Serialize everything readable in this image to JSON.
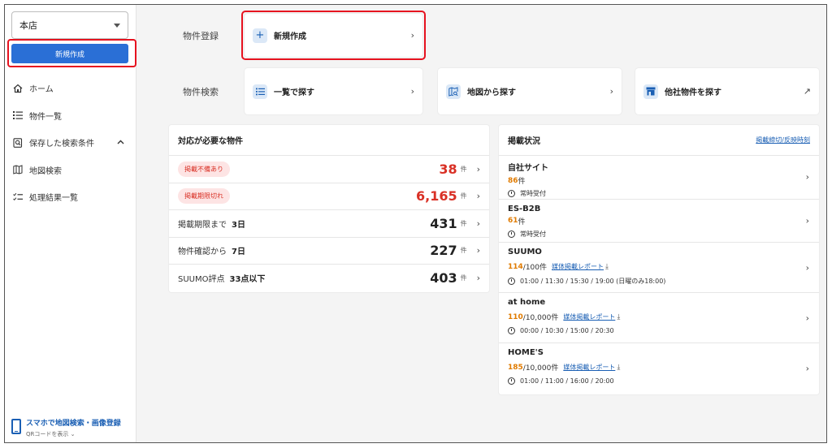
{
  "sidebar": {
    "store": "本店",
    "create_label": "新規作成",
    "nav": [
      {
        "label": "ホーム",
        "icon": "home-icon"
      },
      {
        "label": "物件一覧",
        "icon": "list-icon"
      },
      {
        "label": "保存した検索条件",
        "icon": "saved-search-icon",
        "expanded": true
      },
      {
        "label": "地図検索",
        "icon": "map-icon"
      },
      {
        "label": "処理結果一覧",
        "icon": "checklist-icon"
      }
    ],
    "mobile_title": "スマホで地図検索・画像登録",
    "mobile_sub": "QRコードを表示",
    "mobile_sub_chevron": "⌄"
  },
  "register": {
    "label": "物件登録",
    "new": {
      "label": "新規作成",
      "icon": "+",
      "chevron": "›"
    }
  },
  "search": {
    "label": "物件検索",
    "cards": [
      {
        "label": "一覧で探す",
        "icon": "list-icon",
        "chevron": "›"
      },
      {
        "label": "地図から探す",
        "icon": "map-search-icon",
        "chevron": "›"
      },
      {
        "label": "他社物件を探す",
        "icon": "store-icon",
        "chevron": "↗"
      }
    ]
  },
  "action": {
    "title": "対応が必要な物件",
    "rows": [
      {
        "pill": "掲載不備あり",
        "count": "38",
        "unit": "件"
      },
      {
        "pill": "掲載期限切れ",
        "count": "6,165",
        "unit": "件"
      },
      {
        "label": "掲載期限まで",
        "cond": "3日",
        "count": "431",
        "unit": "件"
      },
      {
        "label": "物件確認から",
        "cond": "7日",
        "count": "227",
        "unit": "件"
      },
      {
        "label": "SUUMO評点",
        "cond": "33点以下",
        "count": "403",
        "unit": "件"
      }
    ]
  },
  "publish": {
    "title": "掲載状況",
    "link": "掲載締切/反映時刻",
    "rows": [
      {
        "name": "自社サイト",
        "count": "86",
        "suffix": "件",
        "time": "常時受付"
      },
      {
        "name": "ES-B2B",
        "count": "61",
        "suffix": "件",
        "time": "常時受付"
      },
      {
        "name": "SUUMO",
        "count": "114",
        "suffix": "/100件",
        "report": "媒体掲載レポート",
        "time": "01:00 / 11:30 / 15:30 / 19:00 (日曜のみ18:00)"
      },
      {
        "name": "at home",
        "count": "110",
        "suffix": "/10,000件",
        "report": "媒体掲載レポート",
        "time": "00:00 / 10:30 / 15:00 / 20:30"
      },
      {
        "name": "HOME'S",
        "count": "185",
        "suffix": "/10,000件",
        "report": "媒体掲載レポート",
        "time": "01:00 / 11:00 / 16:00 / 20:00"
      }
    ]
  },
  "colors": {
    "accent": "#2a6fd6",
    "alert": "#d93025",
    "highlight": "#e6121f",
    "orange": "#e07b00"
  }
}
